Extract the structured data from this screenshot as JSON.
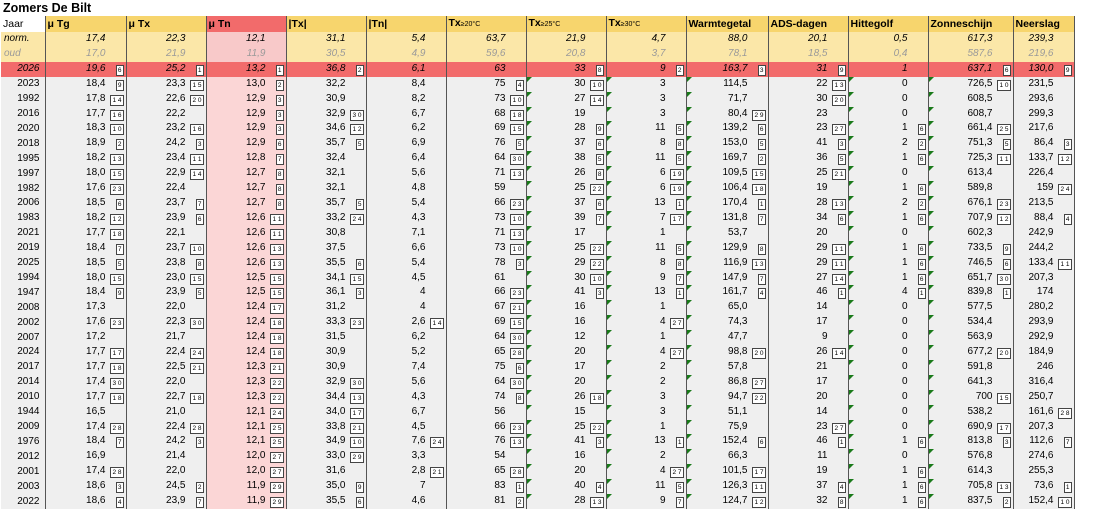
{
  "title": "Zomers De Bilt",
  "columns": [
    {
      "label": "Jaar"
    },
    {
      "label": "μ Tg"
    },
    {
      "label": "μ Tx"
    },
    {
      "label": "μ Tn"
    },
    {
      "label": "|Tx|"
    },
    {
      "label": "|Tn|"
    },
    {
      "label": "Tx",
      "sub": "≥20°C"
    },
    {
      "label": "Tx",
      "sub": "≥25°C"
    },
    {
      "label": "Tx",
      "sub": "≥30°C"
    },
    {
      "label": "Warmtegetal"
    },
    {
      "label": "ADS-dagen"
    },
    {
      "label": "Hittegolf"
    },
    {
      "label": "Zonneschijn"
    },
    {
      "label": "Neerslag"
    }
  ],
  "colors": {
    "header": "#f7d56d",
    "norm_row": "#fbe7a8",
    "current_row": "#f26b6b",
    "tn_column": "#fbd6d6",
    "cell": "#efefef",
    "marker": "#1a7a1a"
  },
  "rows": [
    {
      "type": "norm",
      "year": "norm.",
      "cells": [
        "17,4",
        "22,3",
        "12,1",
        "31,1",
        "5,4",
        "63,7",
        "21,9",
        "4,7",
        "88,0",
        "20,1",
        "0,5",
        "617,3",
        "239,3"
      ]
    },
    {
      "type": "oud",
      "year": "oud",
      "cells": [
        "17,0",
        "21,9",
        "11,9",
        "30,5",
        "4,9",
        "59,6",
        "20,8",
        "3,7",
        "78,1",
        "18,5",
        "0,4",
        "587,6",
        "219,6"
      ]
    },
    {
      "type": "cur",
      "year": "2026",
      "cells": [
        "19,6",
        "25,2",
        "13,2",
        "36,8",
        "6,1",
        "63",
        "33",
        "9",
        "163,7",
        "31",
        "1",
        "637,1",
        "130,0"
      ],
      "badges": [
        "6",
        "1",
        "1",
        "2",
        "",
        "",
        "8",
        "2",
        "3",
        "9",
        "",
        "6",
        "9"
      ]
    },
    {
      "year": "2023",
      "cells": [
        "18,4",
        "23,3",
        "13,0",
        "32,2",
        "8,4",
        "75",
        "30",
        "3",
        "114,5",
        "22",
        "0",
        "726,5",
        "231,5"
      ],
      "badges": [
        "9",
        "1 5",
        "2",
        "",
        "",
        "4",
        "1 0",
        "",
        "",
        "1 3",
        "",
        "1 0",
        ""
      ]
    },
    {
      "year": "1992",
      "cells": [
        "17,8",
        "22,6",
        "12,9",
        "30,9",
        "8,2",
        "73",
        "27",
        "3",
        "71,7",
        "30",
        "0",
        "608,5",
        "293,6"
      ],
      "badges": [
        "1 4",
        "2 0",
        "3",
        "",
        "",
        "1 0",
        "1 4",
        "",
        "",
        "2 0",
        "",
        "",
        ""
      ]
    },
    {
      "year": "2016",
      "cells": [
        "17,7",
        "22,2",
        "12,9",
        "32,9",
        "6,7",
        "68",
        "19",
        "3",
        "80,4",
        "23",
        "0",
        "608,7",
        "299,3"
      ],
      "badges": [
        "1 6",
        "",
        "3",
        "3 0",
        "",
        "1 8",
        "",
        "",
        "2 9",
        "",
        "",
        "",
        ""
      ]
    },
    {
      "year": "2020",
      "cells": [
        "18,3",
        "23,2",
        "12,9",
        "34,6",
        "6,2",
        "69",
        "28",
        "11",
        "139,2",
        "23",
        "1",
        "661,4",
        "217,6"
      ],
      "badges": [
        "1 0",
        "1 6",
        "3",
        "1 2",
        "",
        "1 5",
        "9",
        "5",
        "6",
        "2 7",
        "6",
        "2 5",
        ""
      ]
    },
    {
      "year": "2018",
      "cells": [
        "18,9",
        "24,2",
        "12,9",
        "35,7",
        "6,9",
        "76",
        "37",
        "8",
        "153,0",
        "41",
        "2",
        "751,3",
        "86,4"
      ],
      "badges": [
        "2",
        "3",
        "6",
        "5",
        "",
        "5",
        "6",
        "8",
        "5",
        "3",
        "2",
        "5",
        "3"
      ]
    },
    {
      "year": "1995",
      "cells": [
        "18,2",
        "23,4",
        "12,8",
        "32,4",
        "6,4",
        "64",
        "38",
        "11",
        "169,7",
        "36",
        "1",
        "725,3",
        "133,7"
      ],
      "badges": [
        "1 3",
        "1 1",
        "7",
        "",
        "",
        "3 0",
        "5",
        "5",
        "2",
        "5",
        "6",
        "1 1",
        "1 2"
      ]
    },
    {
      "year": "1997",
      "cells": [
        "18,0",
        "22,9",
        "12,7",
        "32,1",
        "5,6",
        "71",
        "26",
        "6",
        "109,5",
        "25",
        "0",
        "613,4",
        "226,4"
      ],
      "badges": [
        "1 5",
        "1 4",
        "8",
        "",
        "",
        "1 3",
        "8",
        "1 9",
        "1 5",
        "2 1",
        "",
        "",
        ""
      ]
    },
    {
      "year": "1982",
      "cells": [
        "17,6",
        "22,4",
        "12,7",
        "32,1",
        "4,8",
        "59",
        "25",
        "6",
        "106,4",
        "19",
        "1",
        "589,8",
        "159"
      ],
      "badges": [
        "2 3",
        "",
        "8",
        "",
        "",
        "",
        "2 2",
        "1 9",
        "1 8",
        "",
        "6",
        "",
        "2 4"
      ]
    },
    {
      "year": "2006",
      "cells": [
        "18,5",
        "23,7",
        "12,7",
        "35,7",
        "5,4",
        "66",
        "37",
        "13",
        "170,4",
        "28",
        "2",
        "676,1",
        "213,5"
      ],
      "badges": [
        "6",
        "7",
        "8",
        "5",
        "",
        "2 3",
        "6",
        "1",
        "1",
        "1 3",
        "2",
        "2 3",
        ""
      ]
    },
    {
      "year": "1983",
      "cells": [
        "18,2",
        "23,9",
        "12,6",
        "33,2",
        "4,3",
        "73",
        "39",
        "7",
        "131,8",
        "34",
        "1",
        "707,9",
        "88,4"
      ],
      "badges": [
        "1 2",
        "6",
        "1 1",
        "2 4",
        "",
        "1 0",
        "7",
        "1 7",
        "7",
        "6",
        "6",
        "1 2",
        "4"
      ]
    },
    {
      "year": "2021",
      "cells": [
        "17,7",
        "22,1",
        "12,6",
        "30,8",
        "7,1",
        "71",
        "17",
        "1",
        "53,7",
        "20",
        "0",
        "602,3",
        "242,9"
      ],
      "badges": [
        "1 8",
        "",
        "1 1",
        "",
        "",
        "1 3",
        "",
        "",
        "",
        "",
        "",
        "",
        ""
      ]
    },
    {
      "year": "2019",
      "cells": [
        "18,4",
        "23,7",
        "12,6",
        "37,5",
        "6,6",
        "73",
        "25",
        "11",
        "129,9",
        "29",
        "1",
        "733,5",
        "244,2"
      ],
      "badges": [
        "7",
        "1 0",
        "1 3",
        "",
        "",
        "1 0",
        "2 2",
        "5",
        "8",
        "1 1",
        "6",
        "9",
        ""
      ]
    },
    {
      "year": "2025",
      "cells": [
        "18,5",
        "23,8",
        "12,6",
        "35,5",
        "5,4",
        "78",
        "29",
        "8",
        "116,9",
        "29",
        "1",
        "746,5",
        "133,4"
      ],
      "badges": [
        "5",
        "8",
        "1 3",
        "6",
        "",
        "3",
        "2 2",
        "8",
        "1 3",
        "1 1",
        "6",
        "6",
        "1 1"
      ]
    },
    {
      "year": "1994",
      "cells": [
        "18,0",
        "23,0",
        "12,5",
        "34,1",
        "4,5",
        "61",
        "30",
        "9",
        "147,9",
        "27",
        "1",
        "651,7",
        "207,3"
      ],
      "badges": [
        "1 5",
        "1 5",
        "1 5",
        "1 5",
        "",
        "",
        "1 0",
        "7",
        "7",
        "1 4",
        "6",
        "3 0",
        ""
      ]
    },
    {
      "year": "1947",
      "cells": [
        "18,4",
        "23,9",
        "12,5",
        "36,1",
        "4",
        "66",
        "41",
        "13",
        "161,7",
        "46",
        "4",
        "839,8",
        "174"
      ],
      "badges": [
        "9",
        "5",
        "1 5",
        "3",
        "",
        "2 3",
        "3",
        "1",
        "4",
        "1",
        "1",
        "1",
        ""
      ]
    },
    {
      "year": "2008",
      "cells": [
        "17,3",
        "22,0",
        "12,4",
        "31,2",
        "4",
        "67",
        "16",
        "1",
        "65,0",
        "14",
        "0",
        "577,5",
        "280,2"
      ],
      "badges": [
        "",
        "",
        "1 7",
        "",
        "",
        "2 1",
        "",
        "",
        "",
        "",
        "",
        "",
        ""
      ]
    },
    {
      "year": "2002",
      "cells": [
        "17,6",
        "22,3",
        "12,4",
        "33,3",
        "2,6",
        "69",
        "16",
        "4",
        "74,3",
        "17",
        "0",
        "534,4",
        "293,9"
      ],
      "badges": [
        "2 3",
        "3 0",
        "1 8",
        "2 3",
        "1 4",
        "1 5",
        "",
        "2 7",
        "",
        "",
        "",
        "",
        ""
      ]
    },
    {
      "year": "2007",
      "cells": [
        "17,2",
        "21,7",
        "12,4",
        "31,5",
        "6,2",
        "64",
        "12",
        "1",
        "47,7",
        "9",
        "0",
        "563,9",
        "292,9"
      ],
      "badges": [
        "",
        "",
        "1 8",
        "",
        "",
        "3 0",
        "",
        "",
        "",
        "",
        "",
        "",
        ""
      ]
    },
    {
      "year": "2024",
      "cells": [
        "17,7",
        "22,4",
        "12,4",
        "30,9",
        "5,2",
        "65",
        "20",
        "4",
        "98,8",
        "26",
        "0",
        "677,2",
        "184,9"
      ],
      "badges": [
        "1 7",
        "2 4",
        "1 8",
        "",
        "",
        "2 8",
        "",
        "2 7",
        "2 0",
        "1 4",
        "",
        "2 0",
        ""
      ]
    },
    {
      "year": "2017",
      "cells": [
        "17,7",
        "22,5",
        "12,3",
        "30,9",
        "7,4",
        "75",
        "17",
        "2",
        "57,8",
        "21",
        "0",
        "591,8",
        "246"
      ],
      "badges": [
        "1 8",
        "2 1",
        "2 1",
        "",
        "",
        "6",
        "",
        "",
        "",
        "",
        "",
        "",
        ""
      ]
    },
    {
      "year": "2014",
      "cells": [
        "17,4",
        "22,0",
        "12,3",
        "32,9",
        "5,6",
        "64",
        "20",
        "2",
        "86,8",
        "17",
        "0",
        "641,3",
        "316,4"
      ],
      "badges": [
        "3 0",
        "",
        "2 2",
        "3 0",
        "",
        "3 0",
        "",
        "",
        "2 7",
        "",
        "",
        "",
        ""
      ]
    },
    {
      "year": "2010",
      "cells": [
        "17,7",
        "22,7",
        "12,3",
        "34,4",
        "4,3",
        "74",
        "26",
        "3",
        "94,7",
        "20",
        "0",
        "700",
        "250,7"
      ],
      "badges": [
        "1 8",
        "1 8",
        "2 2",
        "1 3",
        "",
        "8",
        "1 8",
        "",
        "2 2",
        "",
        "",
        "1 5",
        ""
      ]
    },
    {
      "year": "1944",
      "cells": [
        "16,5",
        "21,0",
        "12,1",
        "34,0",
        "6,7",
        "56",
        "15",
        "3",
        "51,1",
        "14",
        "0",
        "538,2",
        "161,6"
      ],
      "badges": [
        "",
        "",
        "2 4",
        "1 7",
        "",
        "",
        "",
        "",
        "",
        "",
        "",
        "",
        "2 8"
      ]
    },
    {
      "year": "2009",
      "cells": [
        "17,4",
        "22,4",
        "12,1",
        "33,8",
        "4,5",
        "66",
        "25",
        "1",
        "75,9",
        "23",
        "0",
        "690,9",
        "207,3"
      ],
      "badges": [
        "2 8",
        "2 8",
        "2 5",
        "2 1",
        "",
        "2 3",
        "2 2",
        "",
        "",
        "2 7",
        "",
        "1 7",
        ""
      ]
    },
    {
      "year": "1976",
      "cells": [
        "18,4",
        "24,2",
        "12,1",
        "34,9",
        "7,6",
        "76",
        "41",
        "13",
        "152,4",
        "46",
        "1",
        "813,8",
        "112,6"
      ],
      "badges": [
        "7",
        "3",
        "2 5",
        "1 0",
        "2 4",
        "1 3",
        "3",
        "1",
        "6",
        "1",
        "6",
        "3",
        "7"
      ]
    },
    {
      "year": "2012",
      "cells": [
        "16,9",
        "21,4",
        "12,0",
        "33,0",
        "3,3",
        "54",
        "16",
        "2",
        "66,3",
        "11",
        "0",
        "576,8",
        "274,6"
      ],
      "badges": [
        "",
        "",
        "2 7",
        "2 9",
        "",
        "",
        "",
        "",
        "",
        "",
        "",
        "",
        ""
      ]
    },
    {
      "year": "2001",
      "cells": [
        "17,4",
        "22,0",
        "12,0",
        "31,6",
        "2,8",
        "65",
        "20",
        "4",
        "101,5",
        "19",
        "1",
        "614,3",
        "255,3"
      ],
      "badges": [
        "2 8",
        "",
        "2 7",
        "",
        "2 1",
        "2 8",
        "",
        "2 7",
        "1 7",
        "",
        "6",
        "",
        ""
      ]
    },
    {
      "year": "2003",
      "cells": [
        "18,6",
        "24,5",
        "11,9",
        "35,0",
        "7",
        "83",
        "40",
        "11",
        "126,3",
        "37",
        "1",
        "705,8",
        "73,6"
      ],
      "badges": [
        "3",
        "2",
        "2 9",
        "9",
        "",
        "1",
        "4",
        "5",
        "1 1",
        "4",
        "6",
        "1 3",
        "1"
      ]
    },
    {
      "year": "2022",
      "cells": [
        "18,6",
        "23,9",
        "11,9",
        "35,5",
        "4,6",
        "81",
        "28",
        "9",
        "124,7",
        "32",
        "1",
        "837,5",
        "152,4"
      ],
      "badges": [
        "4",
        "7",
        "2 9",
        "6",
        "",
        "2",
        "1 3",
        "7",
        "1 2",
        "8",
        "6",
        "2",
        "1 0"
      ]
    }
  ]
}
